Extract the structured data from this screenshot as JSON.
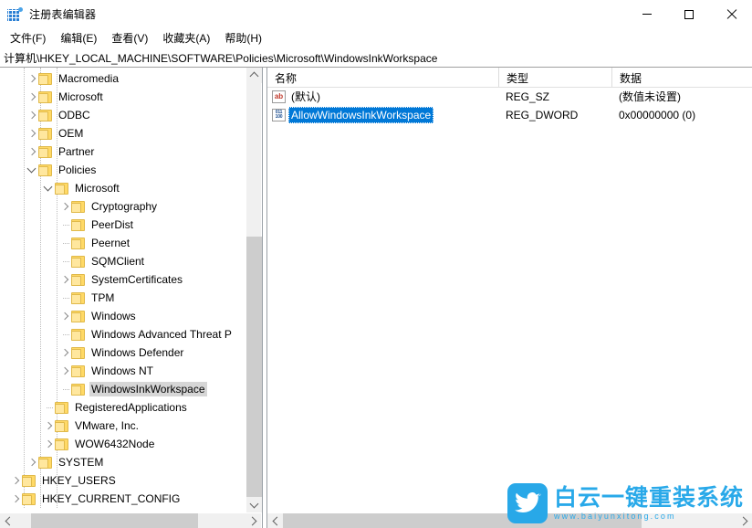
{
  "window": {
    "title": "注册表编辑器",
    "app_icon": "registry-grid-icon",
    "minimize_label": "最小化",
    "maximize_label": "最大化",
    "close_label": "关闭"
  },
  "menubar": {
    "items": [
      {
        "label": "文件(F)",
        "name": "menu-file"
      },
      {
        "label": "编辑(E)",
        "name": "menu-edit"
      },
      {
        "label": "查看(V)",
        "name": "menu-view"
      },
      {
        "label": "收藏夹(A)",
        "name": "menu-favorites"
      },
      {
        "label": "帮助(H)",
        "name": "menu-help"
      }
    ]
  },
  "address": {
    "path": "计算机\\HKEY_LOCAL_MACHINE\\SOFTWARE\\Policies\\Microsoft\\WindowsInkWorkspace"
  },
  "tree": {
    "items": [
      {
        "label": "Macromedia",
        "depth": 3,
        "state": "collapsed",
        "selected": false
      },
      {
        "label": "Microsoft",
        "depth": 3,
        "state": "collapsed",
        "selected": false
      },
      {
        "label": "ODBC",
        "depth": 3,
        "state": "collapsed",
        "selected": false
      },
      {
        "label": "OEM",
        "depth": 3,
        "state": "collapsed",
        "selected": false
      },
      {
        "label": "Partner",
        "depth": 3,
        "state": "collapsed",
        "selected": false
      },
      {
        "label": "Policies",
        "depth": 3,
        "state": "expanded",
        "selected": false
      },
      {
        "label": "Microsoft",
        "depth": 4,
        "state": "expanded",
        "selected": false
      },
      {
        "label": "Cryptography",
        "depth": 5,
        "state": "collapsed",
        "selected": false
      },
      {
        "label": "PeerDist",
        "depth": 5,
        "state": "leaf",
        "selected": false
      },
      {
        "label": "Peernet",
        "depth": 5,
        "state": "leaf",
        "selected": false
      },
      {
        "label": "SQMClient",
        "depth": 5,
        "state": "leaf",
        "selected": false
      },
      {
        "label": "SystemCertificates",
        "depth": 5,
        "state": "collapsed",
        "selected": false
      },
      {
        "label": "TPM",
        "depth": 5,
        "state": "leaf",
        "selected": false
      },
      {
        "label": "Windows",
        "depth": 5,
        "state": "collapsed",
        "selected": false
      },
      {
        "label": "Windows Advanced Threat P",
        "depth": 5,
        "state": "leaf",
        "selected": false
      },
      {
        "label": "Windows Defender",
        "depth": 5,
        "state": "collapsed",
        "selected": false
      },
      {
        "label": "Windows NT",
        "depth": 5,
        "state": "collapsed",
        "selected": false
      },
      {
        "label": "WindowsInkWorkspace",
        "depth": 5,
        "state": "leaf",
        "selected": true
      },
      {
        "label": "RegisteredApplications",
        "depth": 4,
        "state": "leaf",
        "selected": false
      },
      {
        "label": "VMware, Inc.",
        "depth": 4,
        "state": "collapsed",
        "selected": false
      },
      {
        "label": "WOW6432Node",
        "depth": 4,
        "state": "collapsed",
        "selected": false
      },
      {
        "label": "SYSTEM",
        "depth": 3,
        "state": "collapsed",
        "selected": false
      },
      {
        "label": "HKEY_USERS",
        "depth": 2,
        "state": "collapsed",
        "selected": false
      },
      {
        "label": "HKEY_CURRENT_CONFIG",
        "depth": 2,
        "state": "collapsed",
        "selected": false
      }
    ]
  },
  "values": {
    "columns": [
      "名称",
      "类型",
      "数据"
    ],
    "rows": [
      {
        "name": "(默认)",
        "type": "REG_SZ",
        "data": "(数值未设置)",
        "icon": "string-value-ab-icon",
        "selected": false
      },
      {
        "name": "AllowWindowsInkWorkspace",
        "type": "REG_DWORD",
        "data": "0x00000000 (0)",
        "icon": "dword-value-binary-icon",
        "selected": true
      }
    ]
  },
  "scrollbars": {
    "tree_vertical": {
      "thumb_top_pct": 38,
      "thumb_height_pct": 62
    },
    "tree_horizontal": {
      "thumb_left_pct": 6,
      "thumb_width_pct": 64
    },
    "values_horizontal": {
      "thumb_left_pct": 0,
      "thumb_width_pct": 74
    }
  },
  "watermark": {
    "title": "白云一键重装系统",
    "url": "www.baiyunxitong.com",
    "icon": "bird-logo-icon",
    "color": "#29a9e9"
  },
  "colors": {
    "selection_focused": "#0078d7",
    "selection_unfocused": "#d6d6d6",
    "folder_fill": "#ffd966",
    "scrollbar_thumb": "#cdcdcd",
    "window_bg": "#ffffff"
  }
}
